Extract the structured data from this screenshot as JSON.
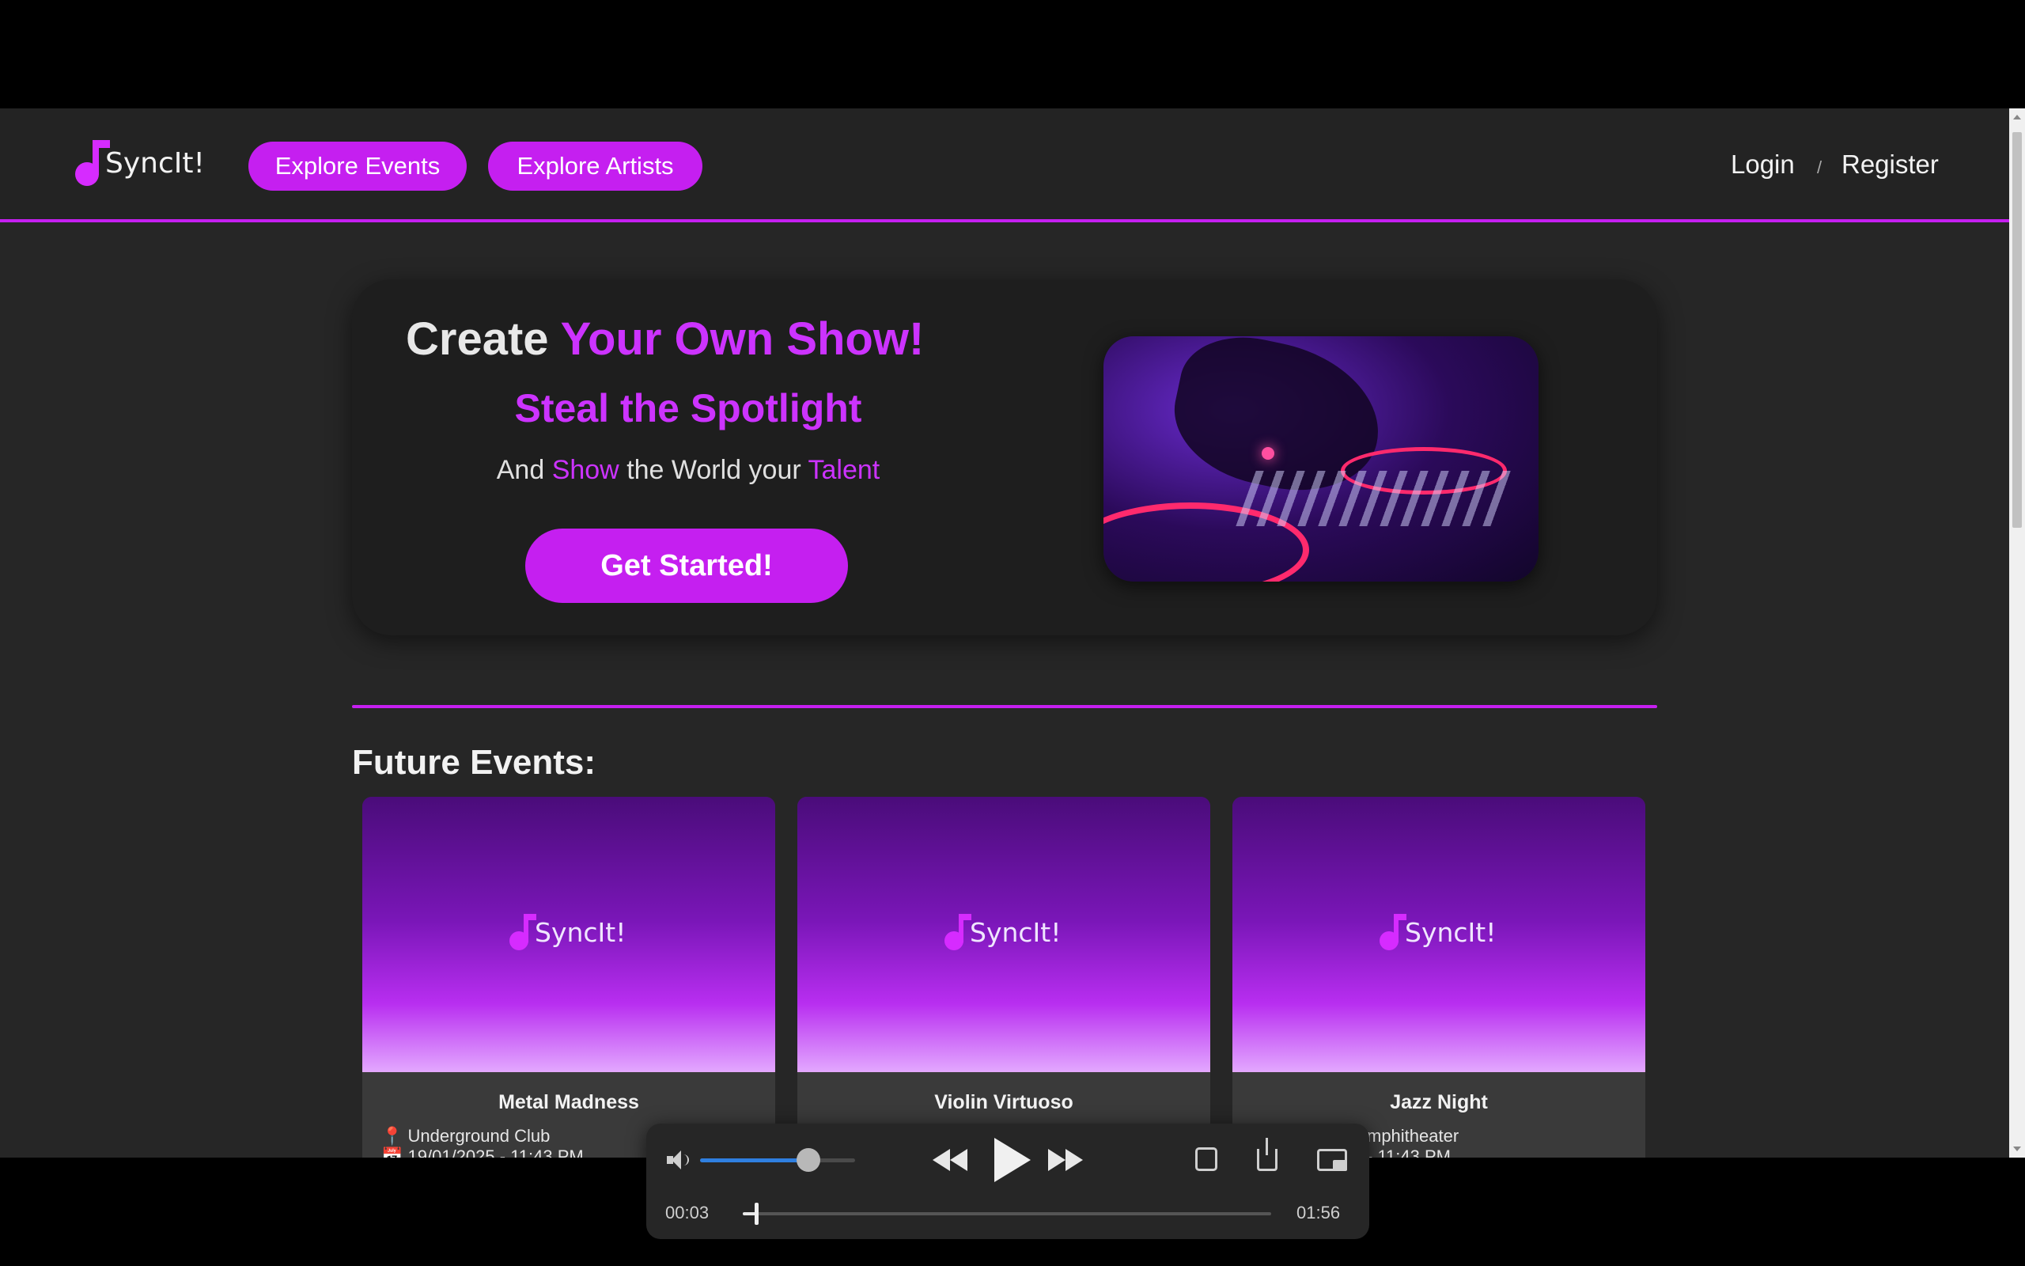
{
  "brand": {
    "name": "SyncIt!",
    "accent": "#c51ff0"
  },
  "nav": {
    "explore_events": "Explore Events",
    "explore_artists": "Explore Artists",
    "login": "Login",
    "separator": "/",
    "register": "Register"
  },
  "hero": {
    "title_white": "Create",
    "title_purple": "Your Own Show!",
    "subtitle": "Steal the Spotlight",
    "tag_and": "And",
    "tag_show": "Show",
    "tag_mid": "the World your",
    "tag_talent": "Talent",
    "cta": "Get Started!",
    "image_icon": "dj-mixer-photo"
  },
  "events": {
    "heading": "Future Events:",
    "cards": [
      {
        "logo": "SyncIt!",
        "title": "Metal Madness",
        "location_icon": "📍",
        "location": "Underground Club",
        "date_icon": "📅",
        "date": "19/01/2025 - 11:43 PM"
      },
      {
        "logo": "SyncIt!",
        "title": "Violin Virtuoso",
        "location_icon": "",
        "location": "",
        "date_icon": "",
        "date": ""
      },
      {
        "logo": "SyncIt!",
        "title": "Jazz Night",
        "location_icon": "",
        "location": "mphitheater",
        "date_icon": "",
        "date": "- 11:43 PM"
      }
    ]
  },
  "player": {
    "current_time": "00:03",
    "total_time": "01:56",
    "volume_fraction": 0.7,
    "progress_fraction": 0.026,
    "icons": [
      "volume-icon",
      "rewind-icon",
      "play-icon",
      "fast-forward-icon",
      "repeat-icon",
      "share-icon",
      "picture-in-picture-icon"
    ]
  }
}
